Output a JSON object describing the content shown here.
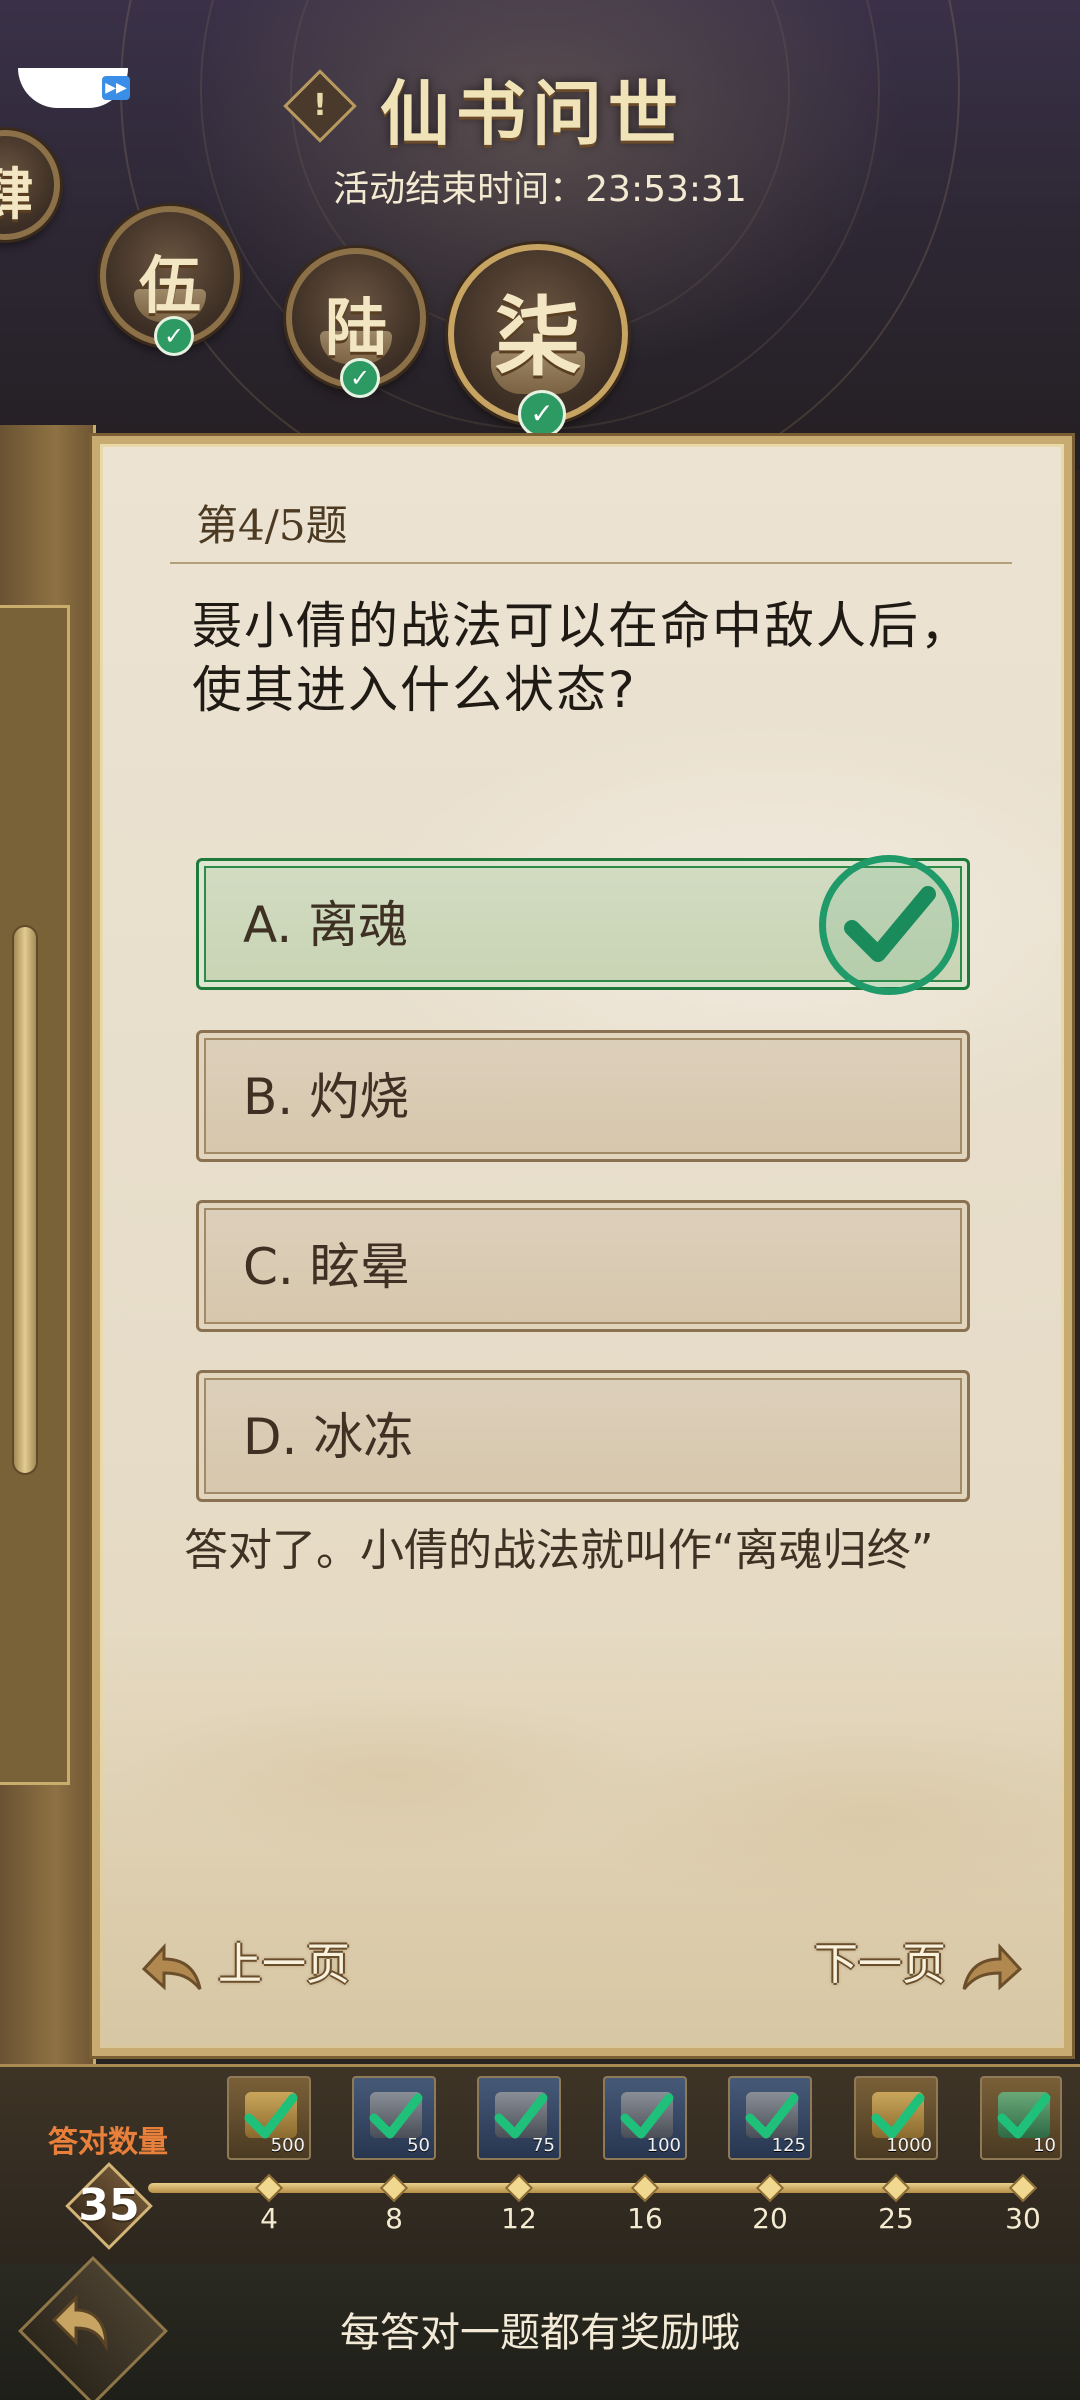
{
  "header": {
    "title": "仙书问世",
    "alert_symbol": "!",
    "end_time_label": "活动结束时间：23:53:31",
    "fast_forward_symbol": "▶▶"
  },
  "chapters": [
    {
      "label": "肆",
      "completed": true
    },
    {
      "label": "伍",
      "completed": true
    },
    {
      "label": "陆",
      "completed": true
    },
    {
      "label": "柒",
      "completed": true,
      "current": true
    }
  ],
  "quiz": {
    "progress": "第4/5题",
    "question": "聂小倩的战法可以在命中敌人后，使其进入什么状态?",
    "options": [
      {
        "label": "A. 离魂",
        "state": "correct"
      },
      {
        "label": "B. 灼烧",
        "state": "normal"
      },
      {
        "label": "C. 眩晕",
        "state": "normal"
      },
      {
        "label": "D. 冰冻",
        "state": "normal"
      }
    ],
    "explanation": "答对了。小倩的战法就叫作“离魂归终”"
  },
  "navigation": {
    "prev_label": "上一页",
    "next_label": "下一页"
  },
  "rewards": {
    "correct_count_label": "答对数量",
    "correct_count": "35",
    "milestones": [
      {
        "threshold": "4",
        "quantity": "500"
      },
      {
        "threshold": "8",
        "quantity": "50"
      },
      {
        "threshold": "12",
        "quantity": "75"
      },
      {
        "threshold": "16",
        "quantity": "100"
      },
      {
        "threshold": "20",
        "quantity": "125"
      },
      {
        "threshold": "25",
        "quantity": "1000"
      },
      {
        "threshold": "30",
        "quantity": "10"
      }
    ]
  },
  "footer": {
    "hint": "每答对一题都有奖励哦"
  },
  "colors": {
    "accent_gold": "#c7ab70",
    "correct_green": "#1f9a68",
    "count_label_orange": "#e87f3a"
  }
}
